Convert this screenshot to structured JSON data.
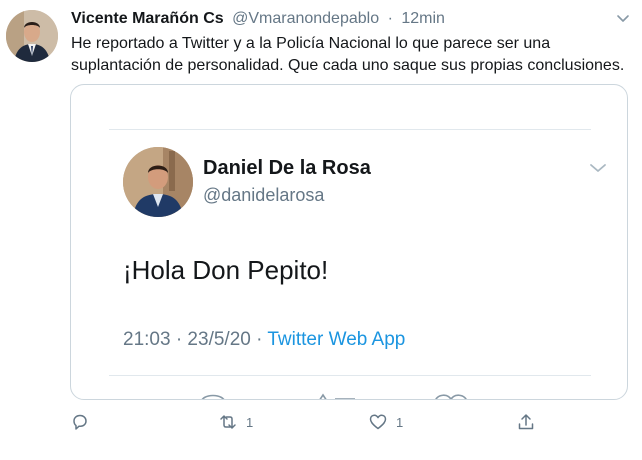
{
  "tweet": {
    "author_name": "Vicente Marañón Cs",
    "author_handle": "@Vmaranondepablo",
    "separator": "·",
    "time": "12min",
    "text": "He reportado a Twitter y a la Policía Nacional lo que parece ser una suplantación de personalidad. Que cada uno saque sus propias conclusiones."
  },
  "embedded_screenshot": {
    "author_name": "Daniel De la Rosa",
    "author_handle": "@danidelarosa",
    "text": "¡Hola Don Pepito!",
    "timestamp": "21:03 · 23/5/20 ·",
    "source": "Twitter Web App"
  },
  "actions": {
    "reply_icon": "reply-icon",
    "retweet_icon": "retweet-icon",
    "retweet_count": "1",
    "like_icon": "heart-icon",
    "like_count": "1",
    "share_icon": "share-icon"
  },
  "colors": {
    "text": "#14171a",
    "muted": "#657786",
    "link": "#1b95e0",
    "border": "#ccd6dd"
  }
}
